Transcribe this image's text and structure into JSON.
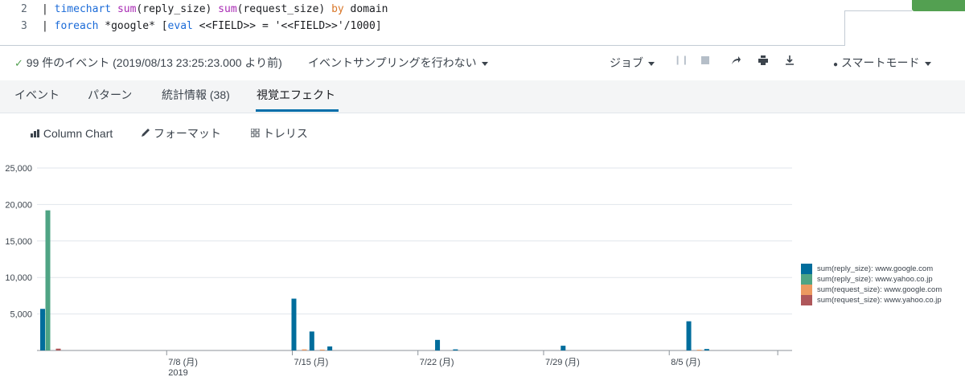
{
  "editor": {
    "lines": [
      {
        "number": "2",
        "tokens": [
          {
            "t": "| ",
            "c": "kw-pipe"
          },
          {
            "t": "timechart",
            "c": "kw-blue"
          },
          {
            "t": " ",
            "c": ""
          },
          {
            "t": "sum",
            "c": "kw-purple"
          },
          {
            "t": "(reply_size) ",
            "c": ""
          },
          {
            "t": "sum",
            "c": "kw-purple"
          },
          {
            "t": "(request_size) ",
            "c": ""
          },
          {
            "t": "by",
            "c": "kw-orange"
          },
          {
            "t": " domain",
            "c": ""
          }
        ]
      },
      {
        "number": "3",
        "tokens": [
          {
            "t": "| ",
            "c": "kw-pipe"
          },
          {
            "t": "foreach",
            "c": "kw-blue"
          },
          {
            "t": " *google* [",
            "c": ""
          },
          {
            "t": "eval",
            "c": "kw-blue"
          },
          {
            "t": " <<FIELD>> = '<<FIELD>>'/1000]",
            "c": ""
          }
        ]
      }
    ]
  },
  "jobbar": {
    "event_count": "99 件のイベント (2019/08/13 23:25:23.000 より前)",
    "sampling": "イベントサンプリングを行わない",
    "job_menu": "ジョブ",
    "smart_mode": "スマートモード",
    "check_icon": "check-icon",
    "pause_icon": "pause-icon",
    "stop_icon": "stop-icon",
    "share_icon": "share-icon",
    "print_icon": "print-icon",
    "export_icon": "export-icon",
    "mode_icon": "lightbulb-icon"
  },
  "tabs": [
    {
      "label": "イベント",
      "active": false
    },
    {
      "label": "パターン",
      "active": false
    },
    {
      "label": "統計情報 (38)",
      "active": false
    },
    {
      "label": "視覚エフェクト",
      "active": true
    }
  ],
  "viz_toolbar": {
    "chart_type": "Column Chart",
    "format": "フォーマット",
    "trellis": "トレリス"
  },
  "chart_data": {
    "type": "bar",
    "title": "",
    "xlabel": "",
    "ylabel": "",
    "ylim": [
      0,
      25000
    ],
    "y_ticks": [
      "5,000",
      "10,000",
      "15,000",
      "20,000",
      "25,000"
    ],
    "y_tick_values": [
      5000,
      10000,
      15000,
      20000,
      25000
    ],
    "x_tick_labels": [
      {
        "day": 7,
        "label": "7/8 (月)",
        "sub": "2019"
      },
      {
        "day": 14,
        "label": "7/15 (月)",
        "sub": ""
      },
      {
        "day": 21,
        "label": "7/22 (月)",
        "sub": ""
      },
      {
        "day": 28,
        "label": "7/29 (月)",
        "sub": ""
      },
      {
        "day": 35,
        "label": "8/5 (月)",
        "sub": ""
      }
    ],
    "x_day_range": [
      0,
      41
    ],
    "grid": true,
    "legend_placement": "right",
    "series": [
      {
        "name": "sum(reply_size): www.google.com",
        "color": "#006d9c"
      },
      {
        "name": "sum(reply_size): www.yahoo.co.jp",
        "color": "#4fa484"
      },
      {
        "name": "sum(request_size): www.google.com",
        "color": "#ec9960"
      },
      {
        "name": "sum(request_size): www.yahoo.co.jp",
        "color": "#af575a"
      }
    ],
    "points": [
      {
        "day": 0,
        "values": [
          5700,
          19200,
          0,
          250
        ]
      },
      {
        "day": 14,
        "values": [
          7100,
          0,
          150,
          0
        ]
      },
      {
        "day": 15,
        "values": [
          2600,
          0,
          120,
          0
        ]
      },
      {
        "day": 16,
        "values": [
          550,
          0,
          0,
          0
        ]
      },
      {
        "day": 22,
        "values": [
          1450,
          0,
          0,
          0
        ]
      },
      {
        "day": 23,
        "values": [
          150,
          0,
          0,
          0
        ]
      },
      {
        "day": 29,
        "values": [
          650,
          0,
          0,
          0
        ]
      },
      {
        "day": 36,
        "values": [
          4000,
          0,
          100,
          0
        ]
      },
      {
        "day": 37,
        "values": [
          200,
          0,
          0,
          0
        ]
      }
    ]
  }
}
